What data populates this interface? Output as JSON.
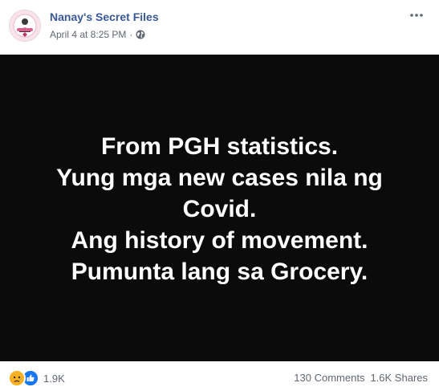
{
  "post": {
    "page_name": "Nanay's Secret Files",
    "timestamp": "April 4 at 8:25 PM",
    "separator": "·",
    "privacy_icon": "globe-icon",
    "more_icon": "more-options-icon",
    "image_lines": [
      "From PGH statistics.",
      "Yung mga new cases nila ng",
      "Covid.",
      "Ang history of movement.",
      "Pumunta lang sa Grocery."
    ],
    "image_background": "#0b0b0b",
    "link_color": "#385898"
  },
  "footer": {
    "reaction_icons": [
      "sad-reaction-icon",
      "like-reaction-icon"
    ],
    "reaction_count": "1.9K",
    "comments": "130 Comments",
    "shares": "1.6K Shares"
  }
}
